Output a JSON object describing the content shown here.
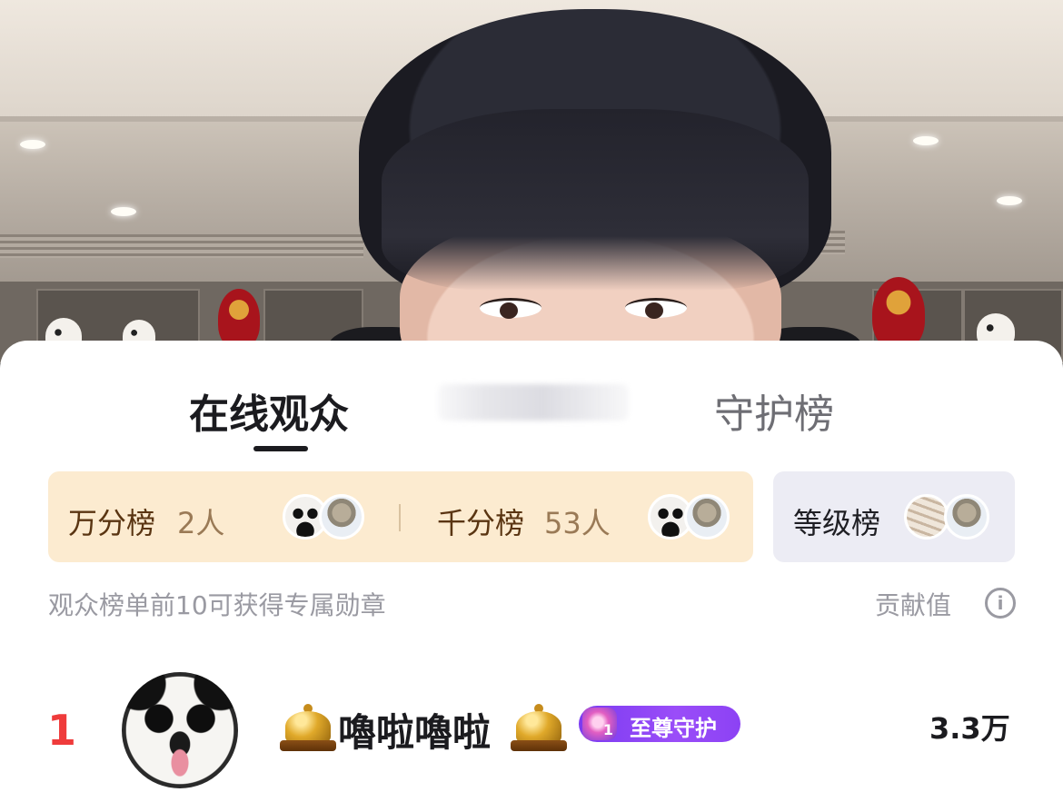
{
  "tabs": {
    "online": "在线观众",
    "guard": "守护榜"
  },
  "rank_cards": {
    "wan": {
      "label": "万分榜",
      "count": "2人"
    },
    "qian": {
      "label": "千分榜",
      "count": "53人"
    },
    "level": {
      "label": "等级榜"
    }
  },
  "hint": "观众榜单前10可获得专属勋章",
  "contribution_label": "贡献值",
  "info_icon_glyph": "i",
  "viewers": [
    {
      "rank": "1",
      "name": "嚕啦嚕啦",
      "badge": "至尊守护",
      "badge_level": "1",
      "score": "3.3万",
      "avatar_icon": "panda-avatar",
      "decor_icon": "service-bell-icon"
    }
  ],
  "colors": {
    "rank_top": "#ef3b3b",
    "gold_card": "#fcebd0",
    "grey_card": "#ececf4",
    "badge_purple": "#8c42f4"
  }
}
